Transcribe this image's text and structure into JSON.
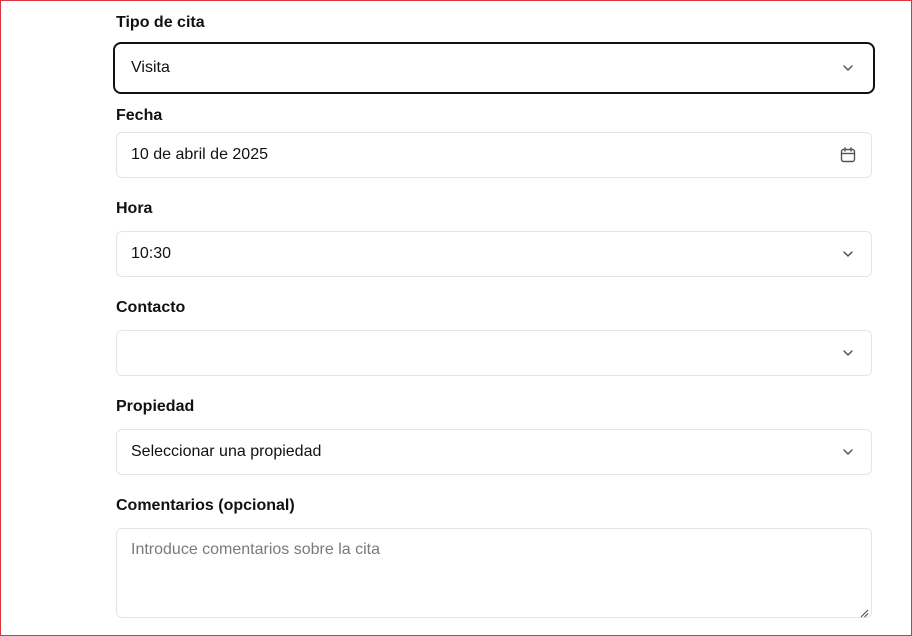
{
  "form": {
    "appointment_type": {
      "label": "Tipo de cita",
      "value": "Visita",
      "icon": "chevron-down-icon"
    },
    "date": {
      "label": "Fecha",
      "value": "10 de abril de 2025",
      "icon": "calendar-icon"
    },
    "time": {
      "label": "Hora",
      "value": "10:30",
      "icon": "chevron-down-icon"
    },
    "contact": {
      "label": "Contacto",
      "value": "",
      "icon": "chevron-down-icon"
    },
    "property": {
      "label": "Propiedad",
      "value": "Seleccionar una propiedad",
      "icon": "chevron-down-icon"
    },
    "comments": {
      "label": "Comentarios (opcional)",
      "placeholder": "Introduce comentarios sobre la cita"
    }
  },
  "colors": {
    "border": "#e5e5e8",
    "focus_border": "#111111",
    "placeholder": "#7a7a7a",
    "frame": "#d9363e"
  }
}
